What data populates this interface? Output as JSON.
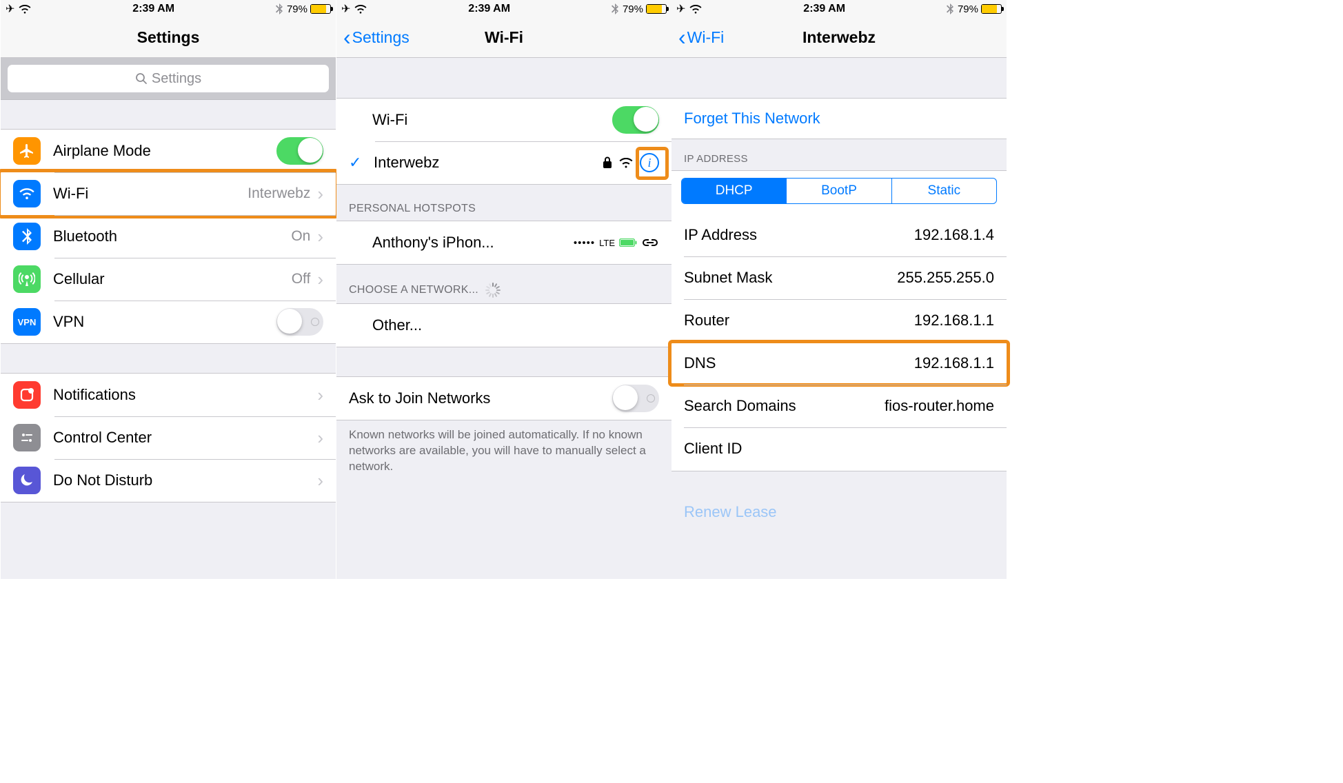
{
  "status": {
    "time": "2:39 AM",
    "battery_pct": "79%"
  },
  "s1": {
    "title": "Settings",
    "search_placeholder": "Settings",
    "rows": {
      "airplane": "Airplane Mode",
      "wifi": "Wi-Fi",
      "wifi_val": "Interwebz",
      "bluetooth": "Bluetooth",
      "bluetooth_val": "On",
      "cellular": "Cellular",
      "cellular_val": "Off",
      "vpn": "VPN",
      "notifications": "Notifications",
      "controlcenter": "Control Center",
      "dnd": "Do Not Disturb"
    }
  },
  "s2": {
    "back": "Settings",
    "title": "Wi-Fi",
    "wifi_label": "Wi-Fi",
    "connected": "Interwebz",
    "hotspots_header": "PERSONAL HOTSPOTS",
    "hotspot_name": "Anthony's iPhon...",
    "hotspot_signal": "•••••",
    "hotspot_net": "LTE",
    "choose_header": "CHOOSE A NETWORK...",
    "other": "Other...",
    "ask_label": "Ask to Join Networks",
    "footer": "Known networks will be joined automatically. If no known networks are available, you will have to manually select a network."
  },
  "s3": {
    "back": "Wi-Fi",
    "title": "Interwebz",
    "forget": "Forget This Network",
    "ip_header": "IP ADDRESS",
    "tabs": {
      "dhcp": "DHCP",
      "bootp": "BootP",
      "static": "Static"
    },
    "rows": {
      "ip": {
        "label": "IP Address",
        "value": "192.168.1.4"
      },
      "subnet": {
        "label": "Subnet Mask",
        "value": "255.255.255.0"
      },
      "router": {
        "label": "Router",
        "value": "192.168.1.1"
      },
      "dns": {
        "label": "DNS",
        "value": "192.168.1.1"
      },
      "search": {
        "label": "Search Domains",
        "value": "fios-router.home"
      },
      "client": {
        "label": "Client ID",
        "value": ""
      }
    },
    "renew": "Renew Lease"
  }
}
